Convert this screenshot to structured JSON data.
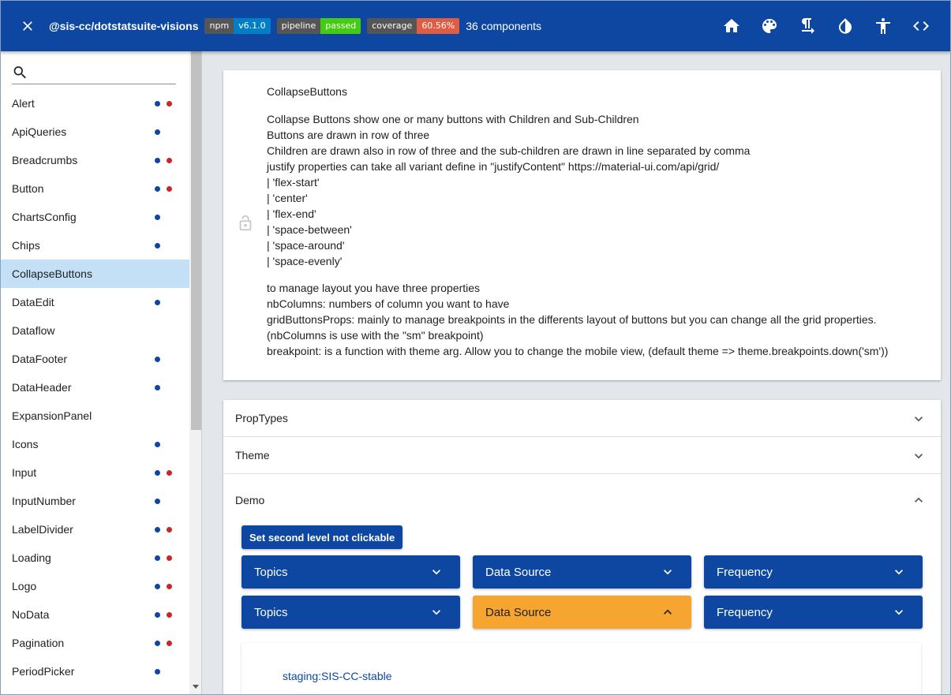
{
  "header": {
    "title": "@sis-cc/dotstatsuite-visions",
    "badges": [
      {
        "label": "npm",
        "value": "v6.1.0",
        "color": "#007ec6"
      },
      {
        "label": "pipeline",
        "value": "passed",
        "color": "#44cc11"
      },
      {
        "label": "coverage",
        "value": "60.56%",
        "color": "#e05d44"
      }
    ],
    "components_count": "36 components",
    "icons": [
      "close-icon",
      "home-icon",
      "palette-icon",
      "text-direction-icon",
      "contrast-icon",
      "accessibility-icon",
      "code-icon"
    ]
  },
  "sidebar": {
    "search": {
      "placeholder": "",
      "value": ""
    },
    "items": [
      {
        "label": "Alert",
        "dots": [
          "blue",
          "red"
        ]
      },
      {
        "label": "ApiQueries",
        "dots": [
          "blue"
        ]
      },
      {
        "label": "Breadcrumbs",
        "dots": [
          "blue",
          "red"
        ]
      },
      {
        "label": "Button",
        "dots": [
          "blue",
          "red"
        ]
      },
      {
        "label": "ChartsConfig",
        "dots": [
          "blue"
        ]
      },
      {
        "label": "Chips",
        "dots": [
          "blue"
        ]
      },
      {
        "label": "CollapseButtons",
        "dots": [],
        "active": true
      },
      {
        "label": "DataEdit",
        "dots": [
          "blue"
        ]
      },
      {
        "label": "Dataflow",
        "dots": []
      },
      {
        "label": "DataFooter",
        "dots": [
          "blue"
        ]
      },
      {
        "label": "DataHeader",
        "dots": [
          "blue"
        ]
      },
      {
        "label": "ExpansionPanel",
        "dots": []
      },
      {
        "label": "Icons",
        "dots": [
          "blue"
        ]
      },
      {
        "label": "Input",
        "dots": [
          "blue",
          "red"
        ]
      },
      {
        "label": "InputNumber",
        "dots": [
          "blue"
        ]
      },
      {
        "label": "LabelDivider",
        "dots": [
          "blue",
          "red"
        ]
      },
      {
        "label": "Loading",
        "dots": [
          "blue",
          "red"
        ]
      },
      {
        "label": "Logo",
        "dots": [
          "blue",
          "red"
        ]
      },
      {
        "label": "NoData",
        "dots": [
          "blue",
          "red"
        ]
      },
      {
        "label": "Pagination",
        "dots": [
          "blue",
          "red"
        ]
      },
      {
        "label": "PeriodPicker",
        "dots": [
          "blue"
        ]
      }
    ]
  },
  "description": {
    "title": "CollapseButtons",
    "block1": [
      "Collapse Buttons show one or many buttons with Children and Sub-Children",
      "Buttons are drawn in row of three",
      "Children are drawn also in row of three and the sub-children are drawn in line separated by comma",
      "justify properties can take all variant define in \"justifyContent\" https://material-ui.com/api/grid/",
      "| 'flex-start'",
      "| 'center'",
      "| 'flex-end'",
      "| 'space-between'",
      "| 'space-around'",
      "| 'space-evenly'"
    ],
    "block2": [
      "to manage layout you have three properties",
      "nbColumns: numbers of column you want to have",
      "gridButtonsProps: mainly to manage breakpoints in the differents layout of buttons but you can change all the grid properties.",
      "(nbColumns is use with the \"sm\" breakpoint)",
      "breakpoint: is a function with theme arg. Allow you to change the mobile view, (default theme => theme.breakpoints.down('sm'))"
    ]
  },
  "panels": {
    "proptypes": "PropTypes",
    "theme": "Theme",
    "demo": "Demo"
  },
  "demo": {
    "set_button": "Set second level not clickable",
    "row1": [
      {
        "label": "Topics",
        "state": "collapsed"
      },
      {
        "label": "Data Source",
        "state": "collapsed"
      },
      {
        "label": "Frequency",
        "state": "collapsed"
      }
    ],
    "row2": [
      {
        "label": "Topics",
        "state": "collapsed"
      },
      {
        "label": "Data Source",
        "state": "expanded"
      },
      {
        "label": "Frequency",
        "state": "collapsed"
      }
    ],
    "sub_item": "staging:SIS-CC-stable"
  },
  "colors": {
    "primary": "#0d47a1",
    "active_item": "#c3e0f6",
    "highlight": "#f6a531",
    "dot_blue": "#0d47a1",
    "dot_red": "#c62828"
  }
}
